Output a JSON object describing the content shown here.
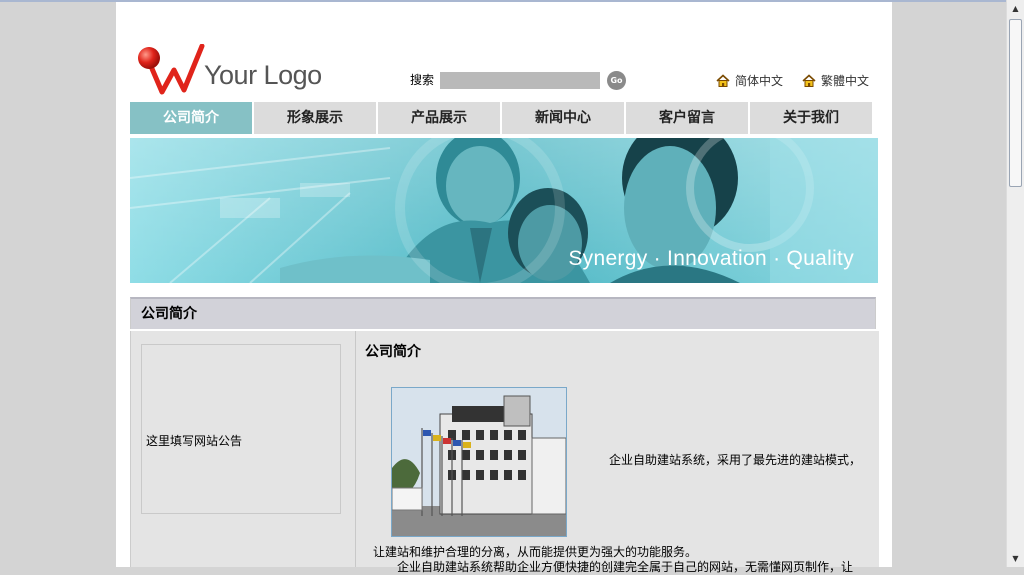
{
  "header": {
    "logo_text": "Your Logo",
    "search_label": "搜索",
    "search_value": "",
    "go_label": "Go",
    "lang_simplified": "简体中文",
    "lang_traditional": "繁體中文"
  },
  "nav": [
    {
      "label": "公司简介",
      "active": true
    },
    {
      "label": "形象展示",
      "active": false
    },
    {
      "label": "产品展示",
      "active": false
    },
    {
      "label": "新闻中心",
      "active": false
    },
    {
      "label": "客户留言",
      "active": false
    },
    {
      "label": "关于我们",
      "active": false
    }
  ],
  "banner": {
    "tagline": "Synergy · Innovation · Quality"
  },
  "section": {
    "title": "公司简介"
  },
  "sidebar": {
    "notice": "这里填写网站公告"
  },
  "main": {
    "title": "公司简介",
    "para1": "企业自助建站系统，采用了最先进的建站模式，",
    "para2": "让建站和维护合理的分离，从而能提供更为强大的功能服务。",
    "para3": "企业自助建站系统帮助企业方便快捷的创建完全属于自己的网站，无需懂网页制作，让"
  },
  "colors": {
    "nav_active": "#86c1c5",
    "nav_inactive": "#dcdcdc",
    "section_head": "#d2d2d9",
    "content_bg": "#e4e4e4",
    "logo_red": "#e0241b"
  }
}
